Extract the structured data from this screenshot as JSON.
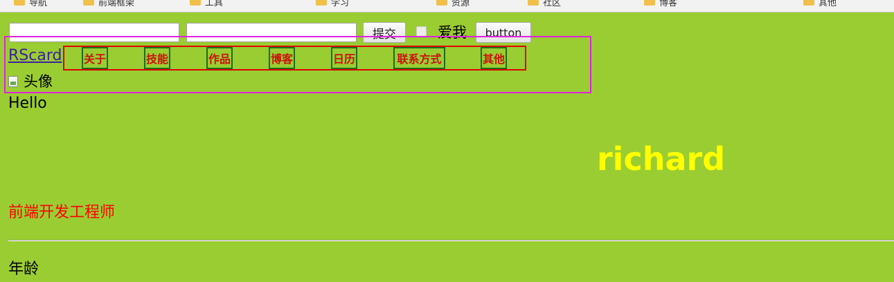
{
  "bookmarks": [
    {
      "label": "导航",
      "icon": "folder-icon"
    },
    {
      "label": "前端框架",
      "icon": "folder-icon"
    },
    {
      "label": "工具",
      "icon": "folder-icon"
    },
    {
      "label": "学习",
      "icon": "folder-icon"
    },
    {
      "label": "资源",
      "icon": "folder-icon"
    },
    {
      "label": "社区",
      "icon": "folder-icon"
    },
    {
      "label": "博客",
      "icon": "folder-icon"
    },
    {
      "label": "其他",
      "icon": "folder-icon"
    }
  ],
  "form": {
    "input1_value": "",
    "input2_value": "",
    "submit_label": "提交",
    "checkbox_label": "爱我",
    "button_label": "button"
  },
  "header": {
    "brand": "RScard",
    "nav": [
      "关于",
      "技能",
      "作品",
      "博客",
      "日历",
      "联系方式",
      "其他"
    ],
    "avatar_alt": "头像"
  },
  "content": {
    "greeting": "Hello",
    "name": "richard",
    "job_title": "前端开发工程师",
    "age_label": "年龄"
  },
  "colors": {
    "background": "#9acd32",
    "name": "#ffff00",
    "job_title": "#ff0000",
    "nav_text": "#cc1010",
    "nav_border": "#1a6f1a",
    "nav_box_border": "#e00000",
    "header_border": "#e020e0"
  }
}
